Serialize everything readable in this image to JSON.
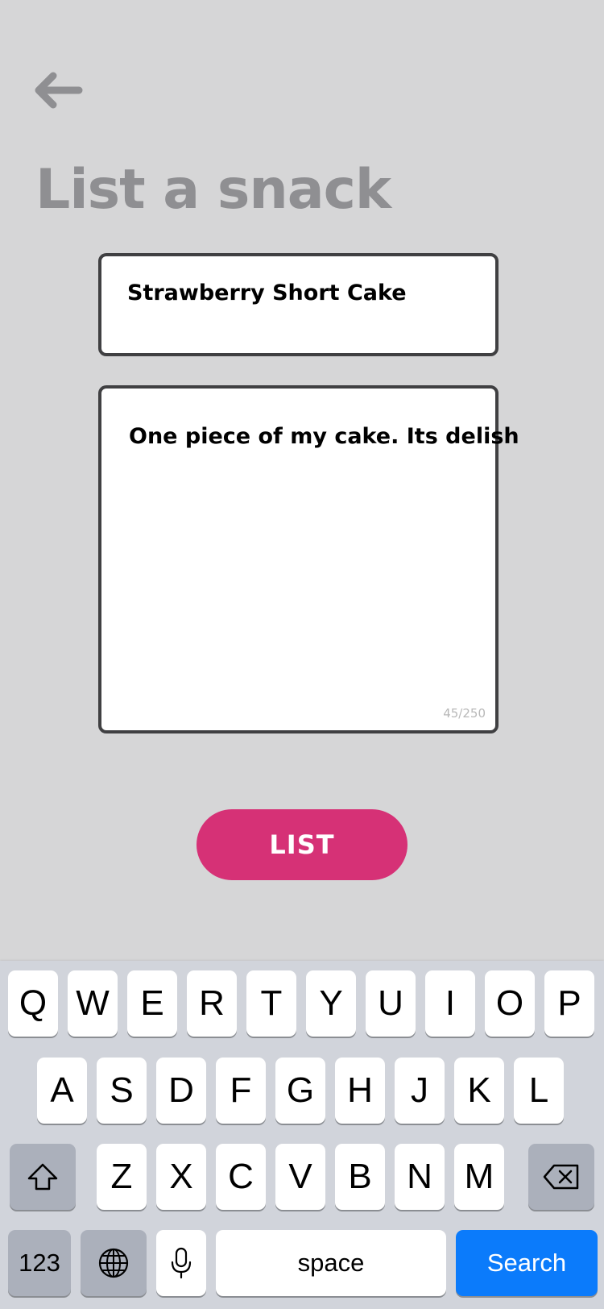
{
  "header": {
    "back_icon": "arrow-left-icon",
    "title": "List a snack"
  },
  "form": {
    "name_value": "Strawberry Short Cake",
    "description_value": "One piece of my cake. Its delish",
    "char_counter": "45/250",
    "submit_label": "LIST",
    "accent_color": "#d63176"
  },
  "keyboard": {
    "row1": [
      "Q",
      "W",
      "E",
      "R",
      "T",
      "Y",
      "U",
      "I",
      "O",
      "P"
    ],
    "row2": [
      "A",
      "S",
      "D",
      "F",
      "G",
      "H",
      "J",
      "K",
      "L"
    ],
    "row3": [
      "Z",
      "X",
      "C",
      "V",
      "B",
      "N",
      "M"
    ],
    "shift_icon": "shift-icon",
    "delete_icon": "backspace-icon",
    "numbers_label": "123",
    "globe_icon": "globe-icon",
    "mic_icon": "microphone-icon",
    "space_label": "space",
    "search_label": "Search",
    "search_color": "#0b7bfb"
  }
}
